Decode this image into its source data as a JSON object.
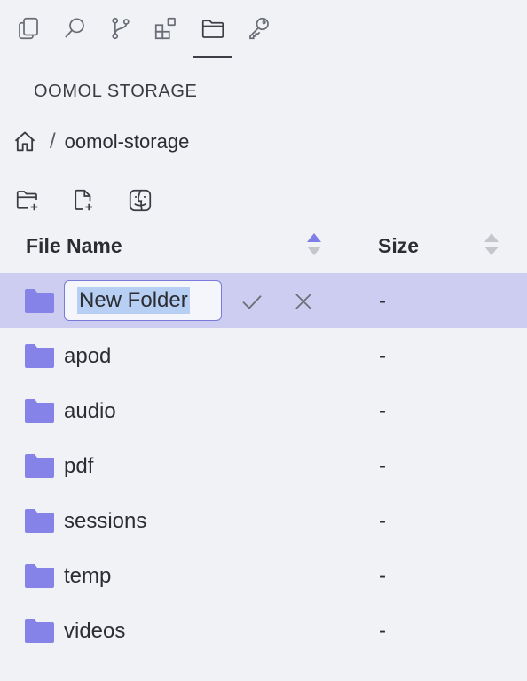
{
  "activity_bar": {
    "icons": [
      "files-icon",
      "search-icon",
      "source-control-icon",
      "extensions-icon",
      "storage-folder-icon",
      "key-icon"
    ],
    "active": "storage-folder-icon"
  },
  "panel": {
    "title": "OOMOL STORAGE"
  },
  "breadcrumb": {
    "separator": "/",
    "current": "oomol-storage"
  },
  "toolbar": {
    "icons": [
      "new-folder-icon",
      "new-file-icon",
      "finder-icon"
    ]
  },
  "table": {
    "columns": {
      "name": "File Name",
      "size": "Size"
    },
    "sort": {
      "column": "name",
      "direction": "ascending"
    },
    "rename": {
      "value": "New Folder",
      "size": "-"
    },
    "rows": [
      {
        "name": "apod",
        "size": "-"
      },
      {
        "name": "audio",
        "size": "-"
      },
      {
        "name": "pdf",
        "size": "-"
      },
      {
        "name": "sessions",
        "size": "-"
      },
      {
        "name": "temp",
        "size": "-"
      },
      {
        "name": "videos",
        "size": "-"
      }
    ]
  },
  "colors": {
    "accent": "#7f7de6",
    "folder": "#8583e8",
    "selected_row": "#cdcdf1",
    "background": "#f1f2f6"
  }
}
